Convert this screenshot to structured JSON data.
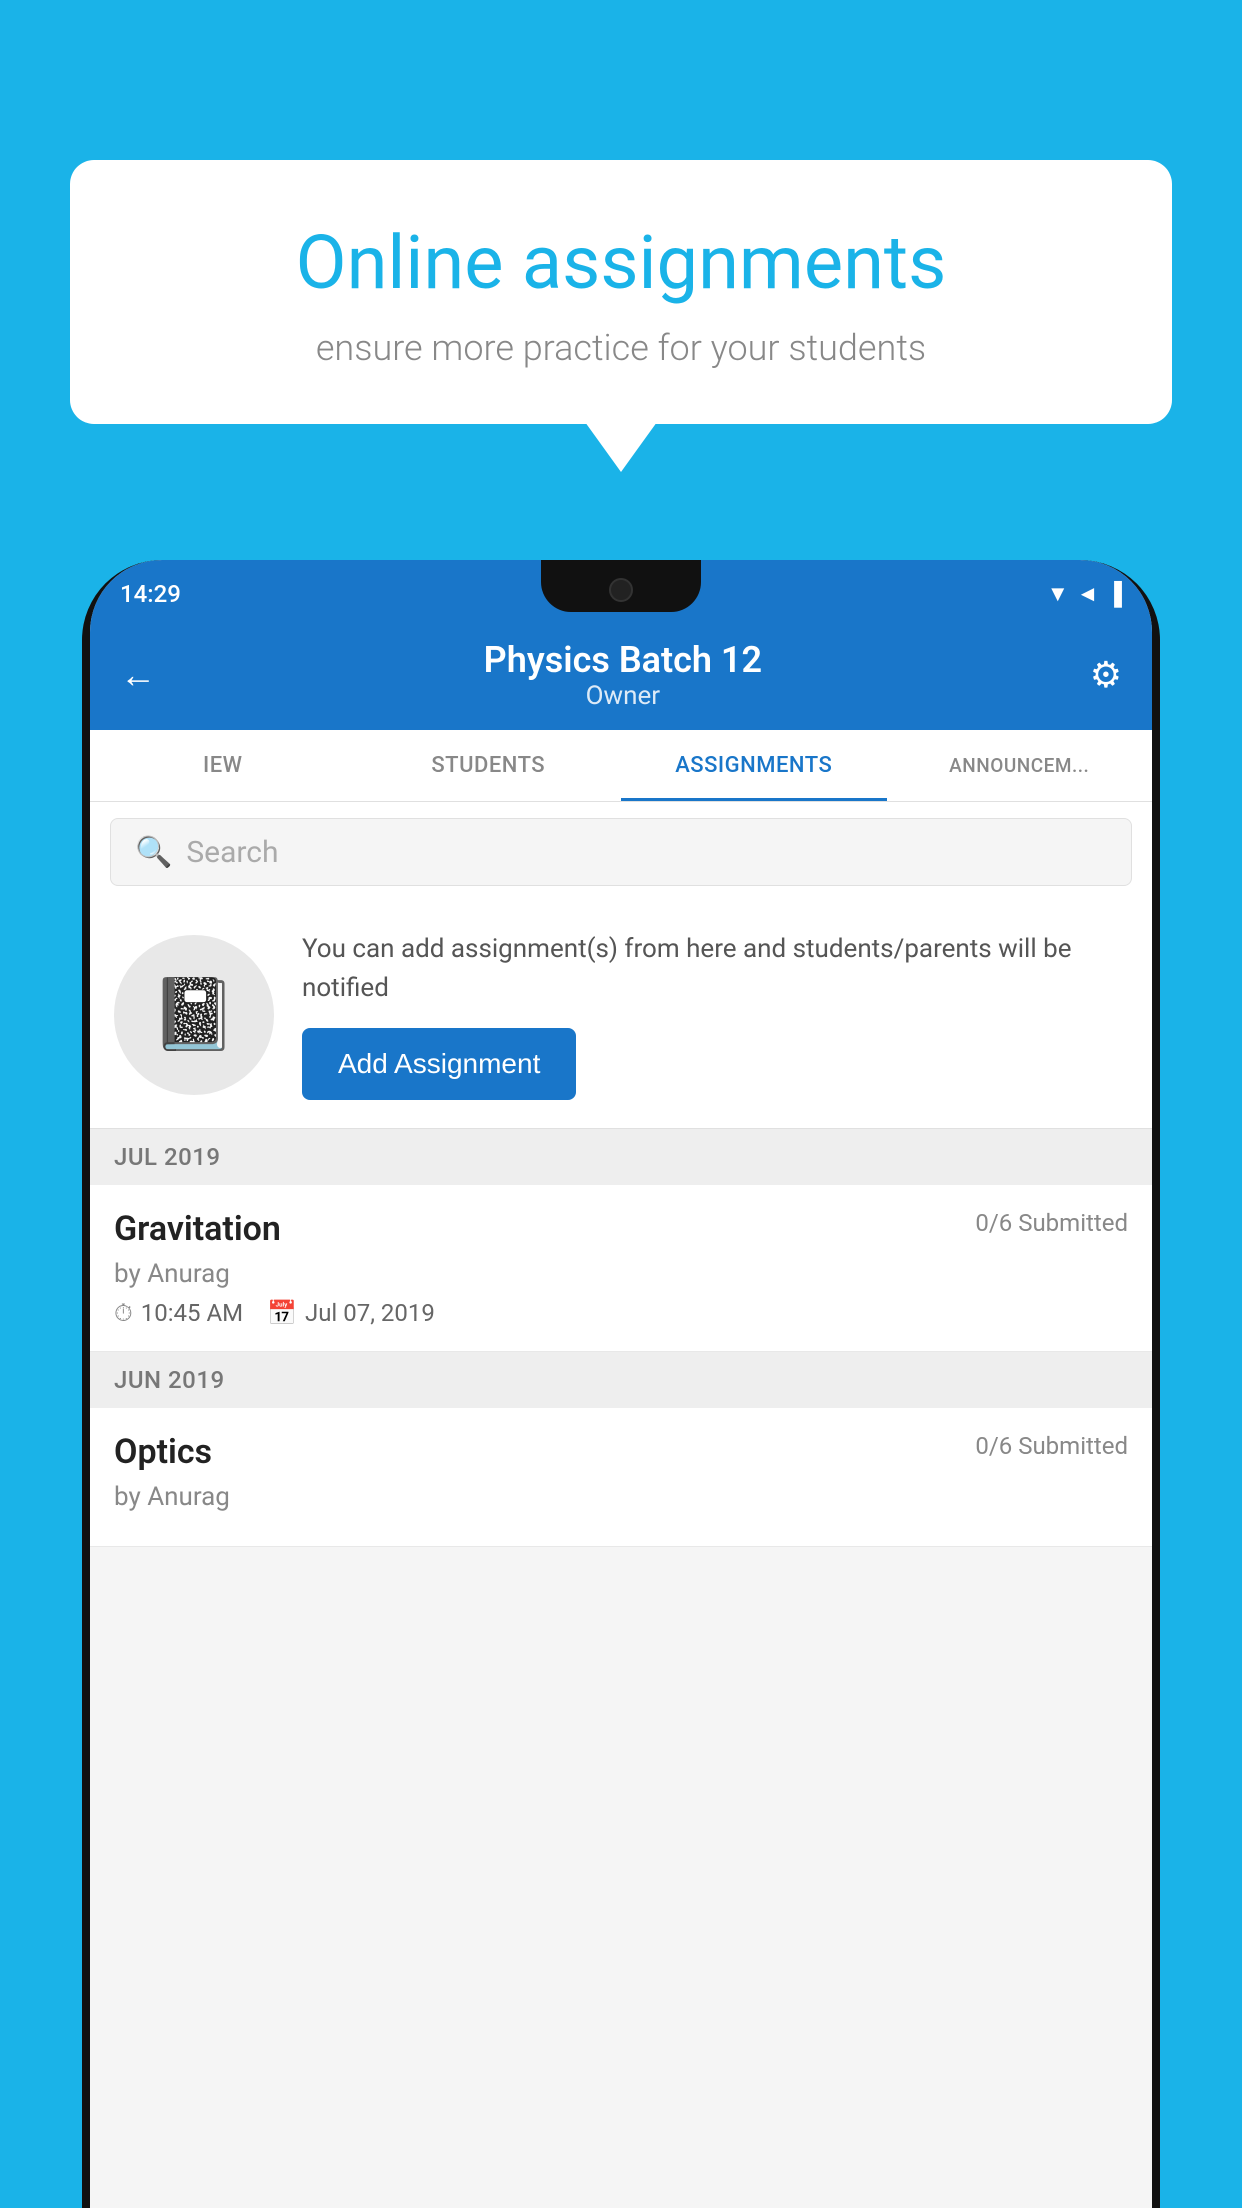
{
  "background_color": "#1ab3e8",
  "speech_bubble": {
    "title": "Online assignments",
    "subtitle": "ensure more practice for your students"
  },
  "phone": {
    "status_bar": {
      "time": "14:29",
      "icons": "▼◄▐"
    },
    "header": {
      "back_label": "←",
      "title": "Physics Batch 12",
      "subtitle": "Owner",
      "settings_label": "⚙"
    },
    "tabs": [
      {
        "label": "IEW",
        "active": false
      },
      {
        "label": "STUDENTS",
        "active": false
      },
      {
        "label": "ASSIGNMENTS",
        "active": true
      },
      {
        "label": "ANNOUNCEM...",
        "active": false
      }
    ],
    "search": {
      "placeholder": "Search"
    },
    "promo": {
      "text": "You can add assignment(s) from here and students/parents will be notified",
      "button_label": "Add Assignment"
    },
    "assignments": [
      {
        "month_label": "JUL 2019",
        "items": [
          {
            "title": "Gravitation",
            "submitted": "0/6 Submitted",
            "author": "by Anurag",
            "time": "10:45 AM",
            "date": "Jul 07, 2019"
          }
        ]
      },
      {
        "month_label": "JUN 2019",
        "items": [
          {
            "title": "Optics",
            "submitted": "0/6 Submitted",
            "author": "by Anurag",
            "time": "",
            "date": ""
          }
        ]
      }
    ]
  }
}
